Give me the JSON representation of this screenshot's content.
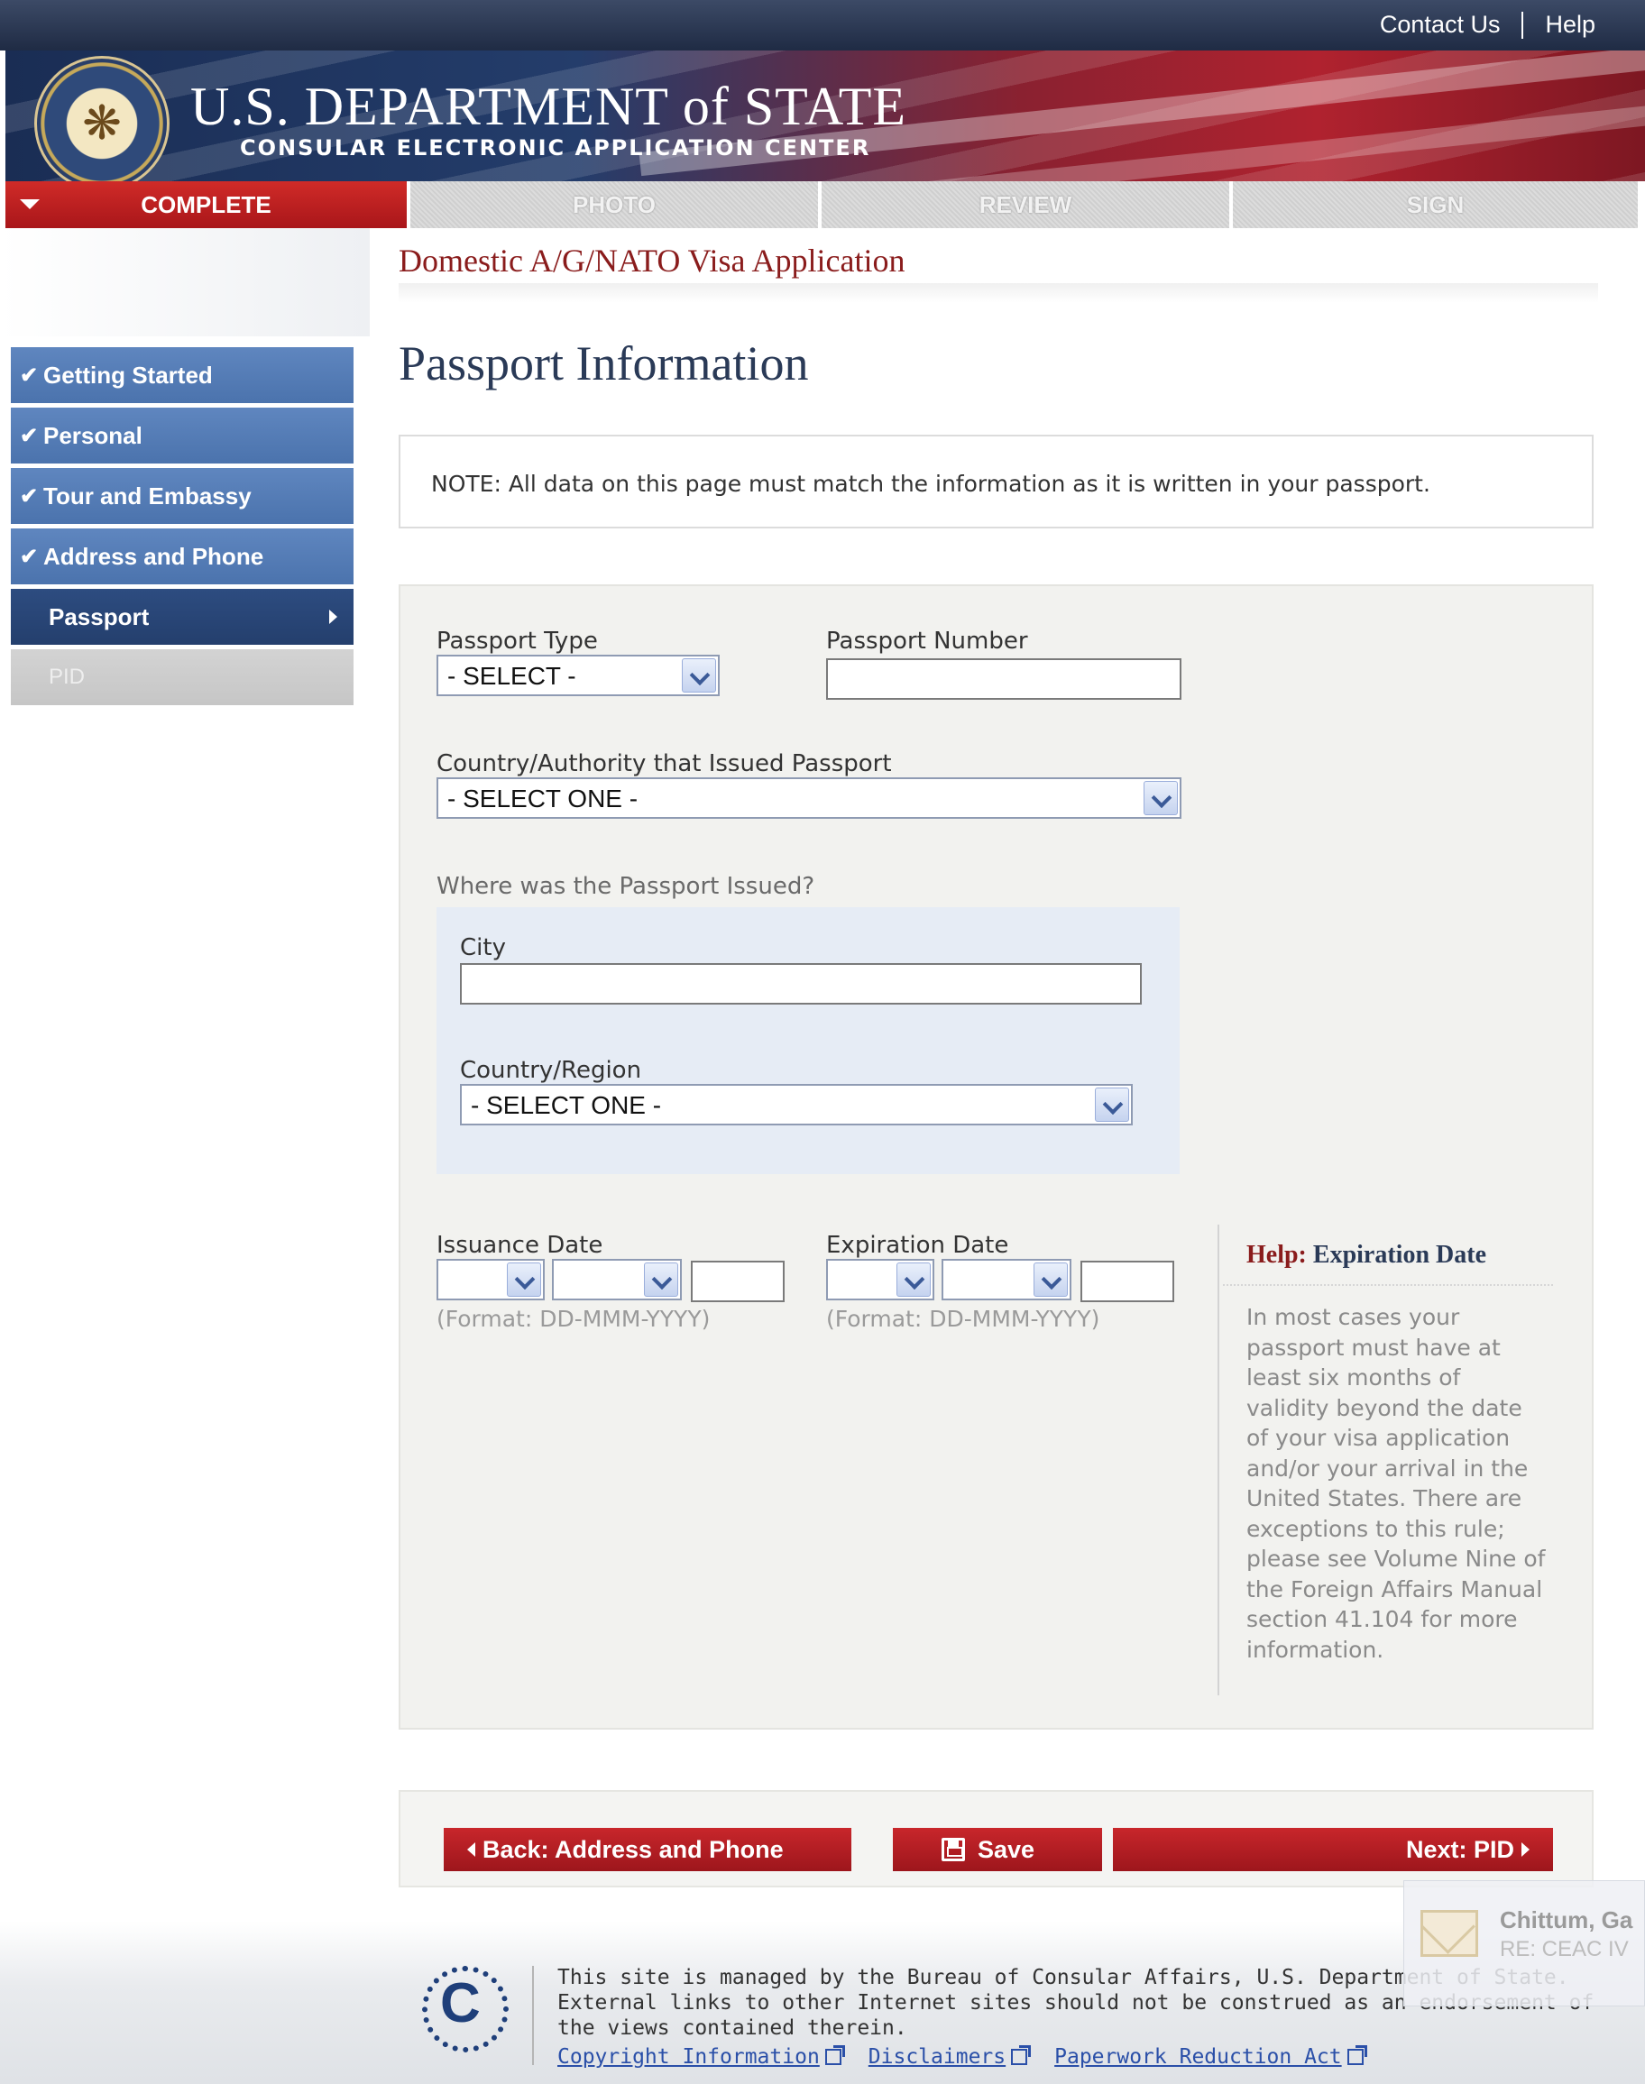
{
  "top_links": {
    "contact": "Contact Us",
    "help": "Help"
  },
  "header": {
    "title": "U.S. DEPARTMENT of STATE",
    "subtitle": "CONSULAR ELECTRONIC APPLICATION CENTER",
    "seal_icon": "state-department-seal-icon"
  },
  "tabs": [
    {
      "label": "COMPLETE",
      "state": "active"
    },
    {
      "label": "PHOTO",
      "state": "inactive"
    },
    {
      "label": "REVIEW",
      "state": "inactive"
    },
    {
      "label": "SIGN",
      "state": "inactive"
    }
  ],
  "sidebar": {
    "items": [
      {
        "label": "Getting Started",
        "status": "complete"
      },
      {
        "label": "Personal",
        "status": "complete"
      },
      {
        "label": "Tour and Embassy",
        "status": "complete"
      },
      {
        "label": "Address and Phone",
        "status": "complete"
      },
      {
        "label": "Passport",
        "status": "current"
      },
      {
        "label": "PID",
        "status": "disabled"
      }
    ]
  },
  "main": {
    "app_title": "Domestic A/G/NATO Visa Application",
    "page_title": "Passport Information",
    "note": "NOTE: All data on this page must match the information as it is written in your passport."
  },
  "form": {
    "passport_type_label": "Passport Type",
    "passport_type_value": "- SELECT -",
    "passport_number_label": "Passport Number",
    "passport_number_value": "",
    "issuing_country_label": "Country/Authority that Issued Passport",
    "issuing_country_value": "- SELECT ONE -",
    "where_issued_label": "Where was the Passport Issued?",
    "city_label": "City",
    "city_value": "",
    "country_region_label": "Country/Region",
    "country_region_value": "- SELECT ONE -",
    "issuance_date_label": "Issuance Date",
    "expiration_date_label": "Expiration Date",
    "date_format": "(Format: DD-MMM-YYYY)"
  },
  "help": {
    "prefix": "Help:",
    "title": "Expiration Date",
    "text": "In most cases your passport must have at least six months of validity beyond the date of your visa application and/or your arrival in the United States. There are exceptions to this rule; please see Volume Nine of the Foreign Affairs Manual section 41.104 for more information."
  },
  "buttons": {
    "back": "Back: Address and Phone",
    "save": "Save",
    "next": "Next: PID"
  },
  "footer": {
    "line1": "This site is managed by the Bureau of Consular Affairs, U.S. Department of State.",
    "line2": "External links to other Internet sites should not be construed as an endorsement of",
    "line3": "the views contained therein.",
    "links": [
      "Copyright Information",
      "Disclaimers",
      "Paperwork Reduction Act"
    ]
  },
  "notification": {
    "sender": "Chittum, Ga",
    "subject": "RE: CEAC IV"
  }
}
